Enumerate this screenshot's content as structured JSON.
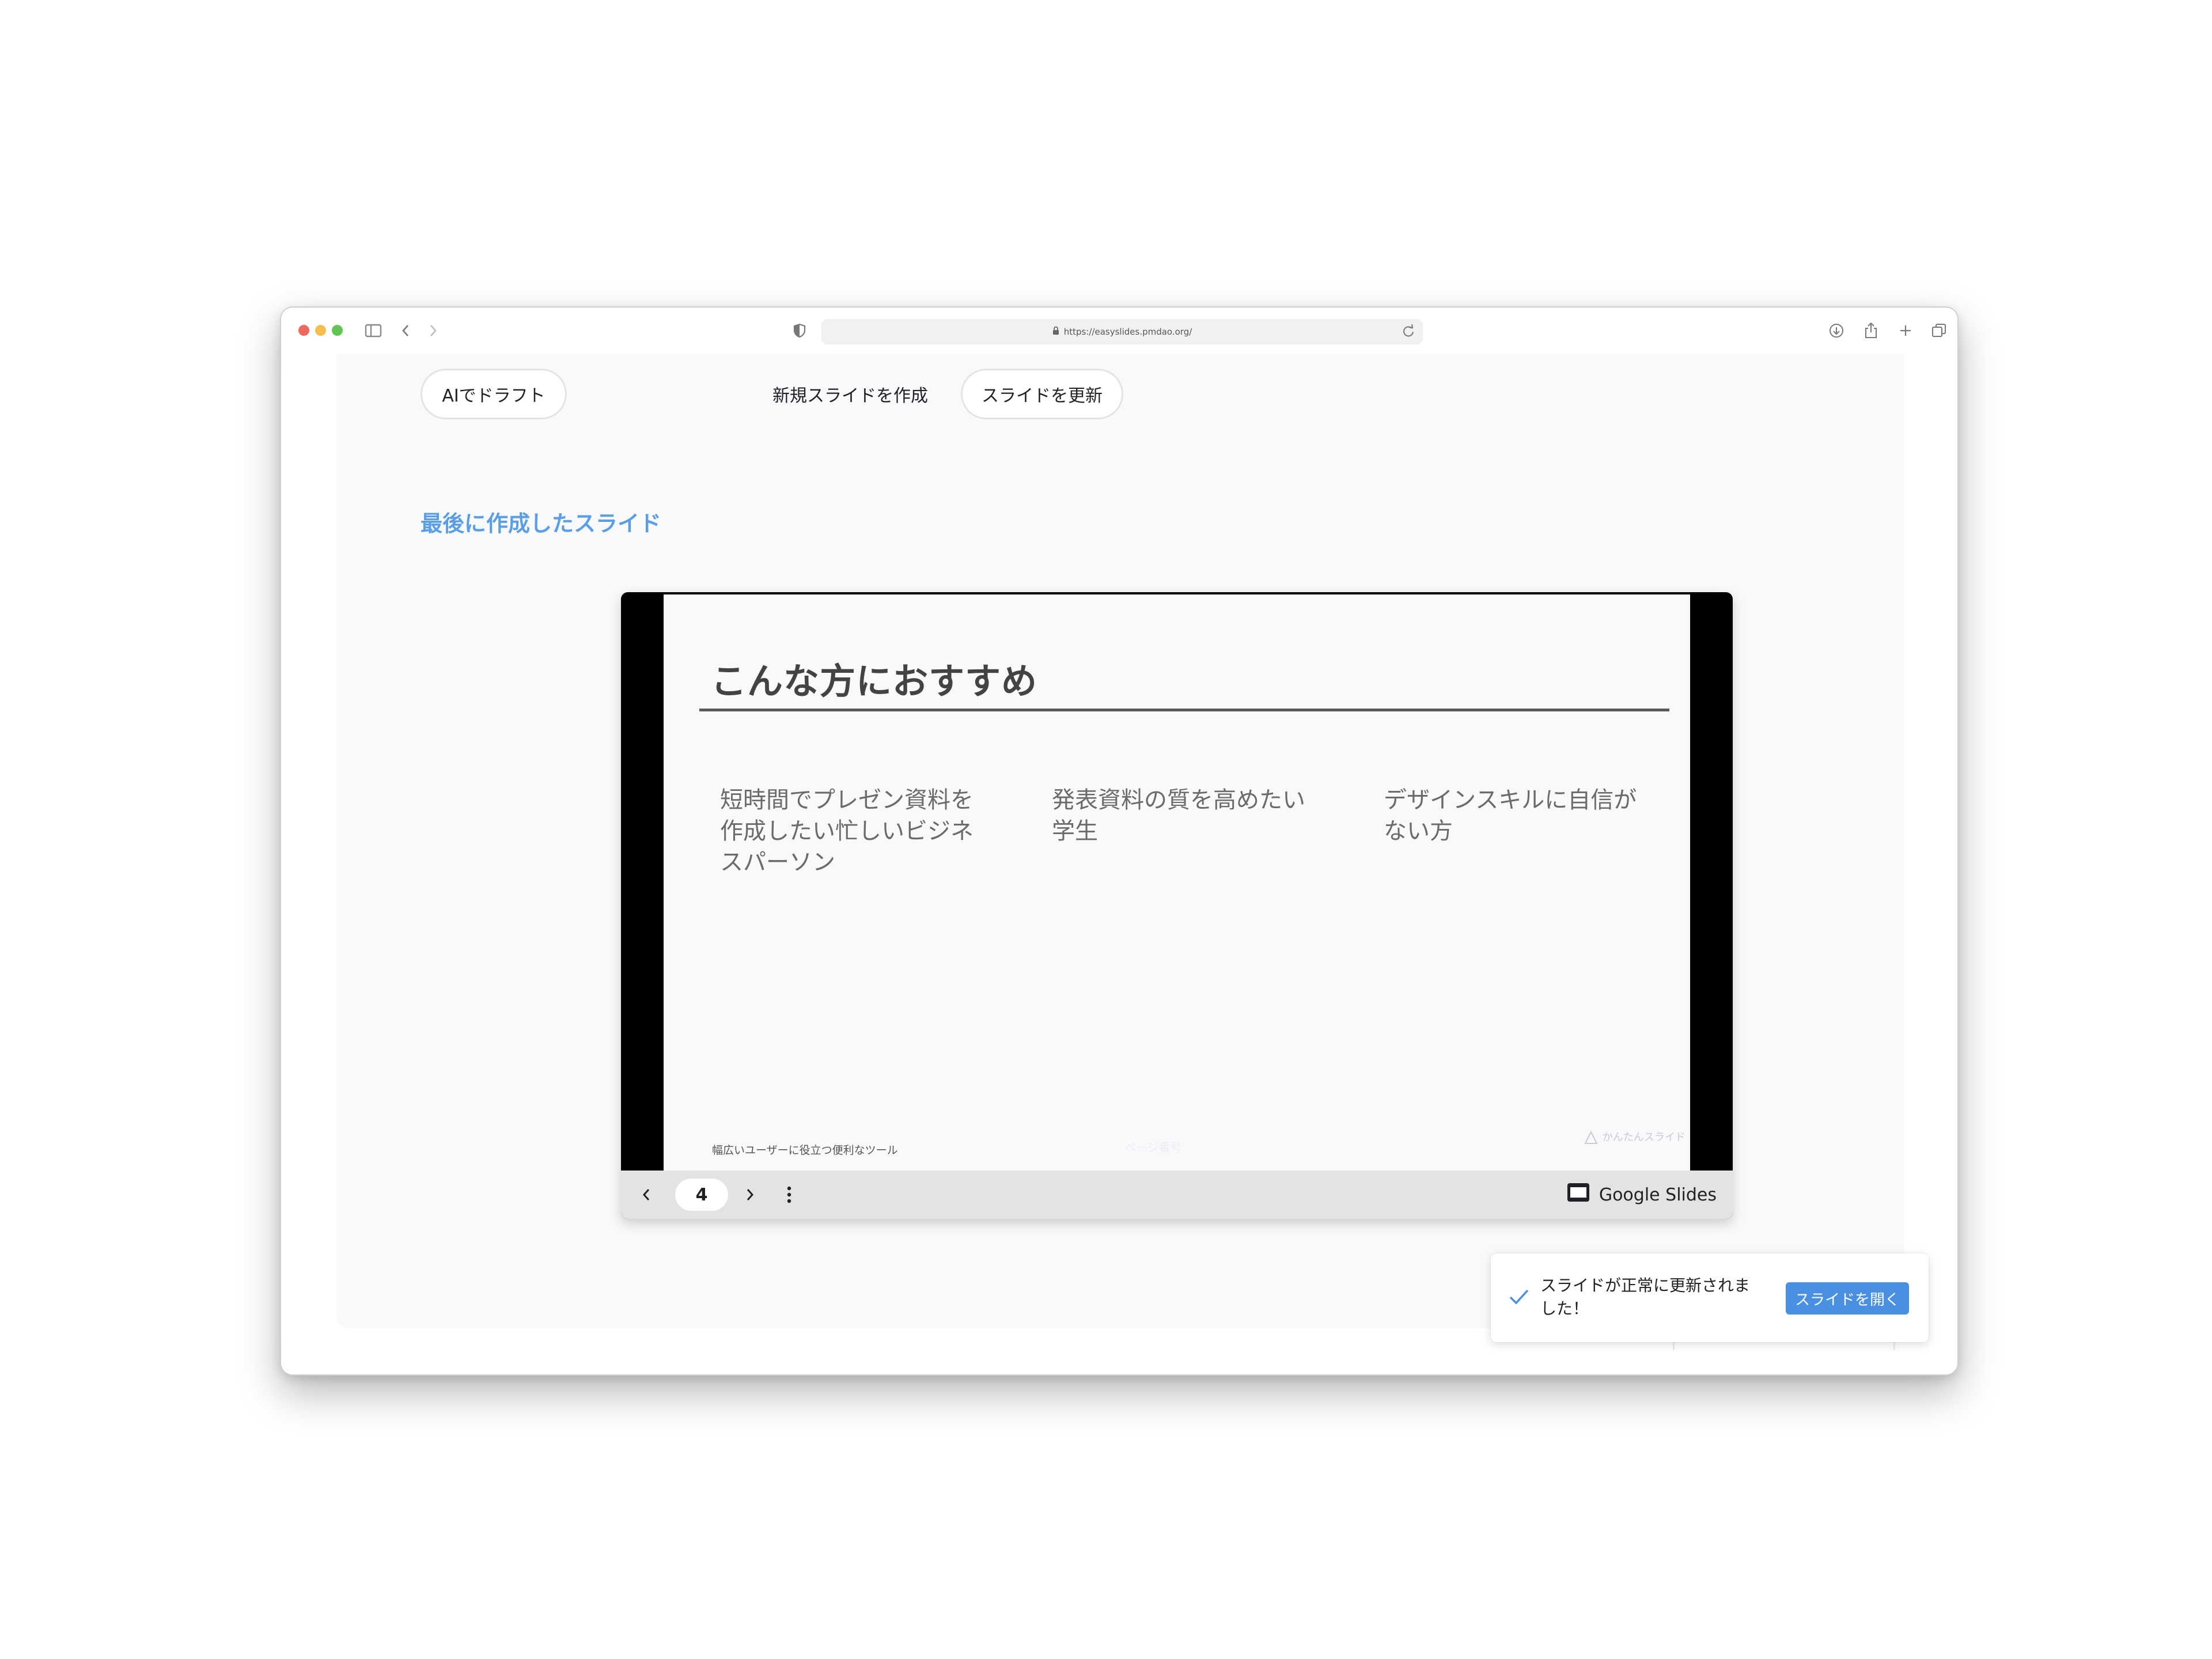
{
  "browser": {
    "url": "https://easyslides.pmdao.org/",
    "icons": [
      "sidebar-icon",
      "back-icon",
      "forward-icon",
      "shield-icon",
      "lock-icon",
      "reload-icon",
      "download-icon",
      "share-icon",
      "new-tab-icon",
      "tabs-overview-icon"
    ]
  },
  "toolbar": {
    "ai_draft_label": "AIでドラフト",
    "new_slide_label": "新規スライドを作成",
    "update_slide_label": "スライドを更新"
  },
  "section": {
    "title": "最後に作成したスライド"
  },
  "slide": {
    "title": "こんな方におすすめ",
    "columns": [
      "短時間でプレゼン資料を作成したい忙しいビジネスパーソン",
      "発表資料の質を高めたい学生",
      "デザインスキルに自信がない方"
    ],
    "footer": "幅広いユーザーに役立つ便利なツール",
    "faint_text": "ページ番号",
    "logo_text": "かんたんスライド"
  },
  "player": {
    "page_number": "4",
    "brand": "Google Slides"
  },
  "toast": {
    "message": "スライドが正常に更新されました！",
    "action_label": "スライドを開く"
  },
  "colors": {
    "accent": "#5b9ee3",
    "toast_button": "#4a90e2",
    "slide_bg": "#f8f9fb"
  }
}
